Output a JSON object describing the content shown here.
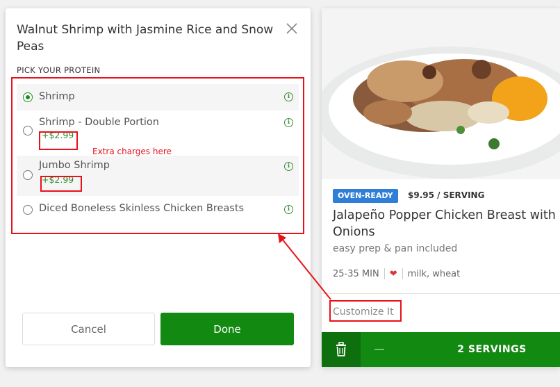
{
  "modal": {
    "title": "Walnut Shrimp with Jasmine Rice and Snow Peas",
    "section_label": "PICK YOUR PROTEIN",
    "options": [
      {
        "name": "Shrimp",
        "price": "",
        "selected": true
      },
      {
        "name": "Shrimp - Double Portion",
        "price": "+$2.99",
        "selected": false
      },
      {
        "name": "Jumbo Shrimp",
        "price": "+$2.99",
        "selected": false
      },
      {
        "name": "Diced Boneless Skinless Chicken Breasts",
        "price": "",
        "selected": false
      }
    ],
    "cancel_label": "Cancel",
    "done_label": "Done"
  },
  "card": {
    "badge": "OVEN-READY",
    "price": "$9.95 / SERVING",
    "title": "Jalapeño Popper Chicken Breast with Onions",
    "subtitle": "easy prep & pan included",
    "time": "25-35 MIN",
    "allergens": "milk, wheat",
    "customize_label": "Customize It",
    "servings_label": "2 SERVINGS"
  },
  "annotation": {
    "text": "Extra charges here"
  },
  "colors": {
    "primary_green": "#128a12",
    "badge_blue": "#2f7fd8",
    "annotation_red": "#e8111a"
  },
  "icons": {
    "close": "close-icon",
    "info": "info-icon",
    "trash": "trash-icon",
    "heart": "heart-icon",
    "minus": "minus-icon"
  }
}
